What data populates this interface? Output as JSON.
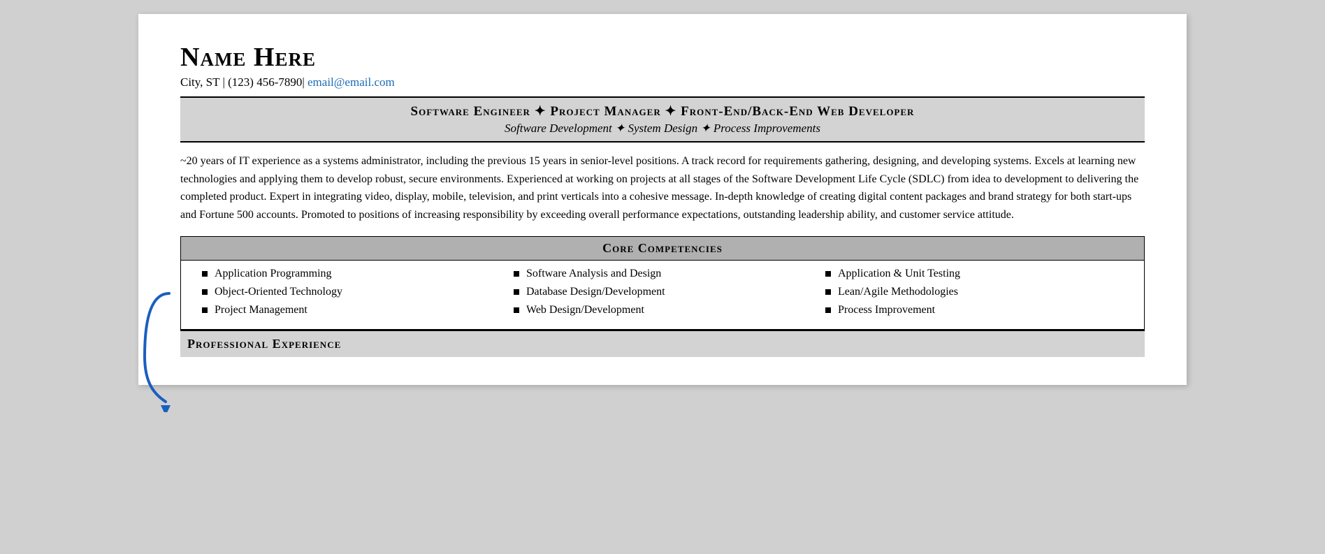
{
  "header": {
    "name": "Name Here",
    "contact": "City, ST | (123) 456-7890|",
    "email_label": "email@email.com",
    "email_href": "mailto:email@email.com"
  },
  "title_bar": {
    "main": "Software Engineer ✦ Project Manager ✦ Front-End/Back-End Web Developer",
    "sub": "Software Development ✦ System Design ✦ Process Improvements"
  },
  "summary": "~20 years of IT experience as a systems administrator, including the previous 15 years in senior-level positions. A track record for requirements gathering, designing, and developing systems. Excels at learning new technologies and applying them to develop robust, secure environments. Experienced at working on projects at all stages of the Software Development Life Cycle (SDLC) from idea to development to delivering the completed product. Expert in integrating video, display, mobile, television, and print verticals into a cohesive message. In-depth knowledge of creating digital content packages and brand strategy for both start-ups and Fortune 500 accounts. Promoted to positions of increasing responsibility by exceeding overall performance expectations, outstanding leadership ability, and customer service attitude.",
  "core_competencies": {
    "title": "Core Competencies",
    "columns": [
      [
        "Application Programming",
        "Object-Oriented Technology",
        "Project Management"
      ],
      [
        "Software Analysis and Design",
        "Database Design/Development",
        "Web Design/Development"
      ],
      [
        "Application & Unit Testing",
        "Lean/Agile Methodologies",
        "Process Improvement"
      ]
    ]
  },
  "professional_experience": {
    "title": "Professional Experience"
  }
}
